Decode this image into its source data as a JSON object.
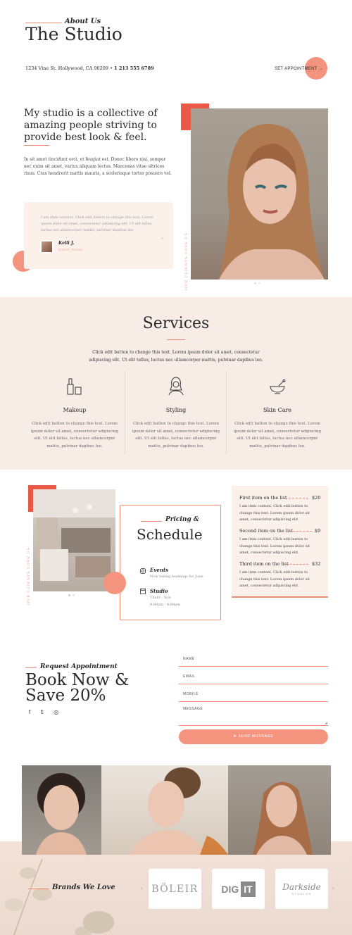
{
  "header": {
    "eyebrow": "About Us",
    "title": "The Studio",
    "address": "1234 Vine St. Hollywood, CA 90209",
    "bullet": "•",
    "phone": "1 213 555 6789",
    "appointment_label": "SET APPOINTMENT",
    "appointment_arrow": "→"
  },
  "about": {
    "headline_1": "My studio is a collective of",
    "headline_2": "amazing people striving to",
    "headline_3": "provide best look & feel.",
    "paragraph": "In sit amet tincidunt orci, et feugiat est. Donec libero nisi, semper nec enim sit amet, varius aliquam lectus. Maecenas vitae ultrices risus. Cras hendrerit mattis mauris, a scelerisque tortor posuere vel.",
    "testimonial_text": "I am slide content. Click edit button to change this text. Lorem ipsum dolor sit amet, consectetur adipiscing elit. Ut elit tellus, luctus nec ullamcorper mattis, pulvinar dapibus leo.",
    "testimonial_name": "Kelli J.",
    "testimonial_handle": "@kelli_beauty",
    "vertical_text": "OUR CLIENTS LOVE US"
  },
  "services": {
    "title": "Services",
    "description_1": "Click edit button to change this text. Lorem ipsum dolor sit amet, consectetur",
    "description_2": "adipiscing elit. Ut elit tellus, luctus nec ullamcorper mattis, pulvinar dapibus leo.",
    "items": [
      {
        "title": "Makeup",
        "icon": "makeup-icon",
        "text": "Click edit button to change this text. Lorem ipsum dolor sit amet, consectetur adipiscing elit. Ut elit tellus, luctus nec ullamcorper mattis, pulvinar dapibus leo."
      },
      {
        "title": "Styling",
        "icon": "woman-icon",
        "text": "Click edit button to change this text. Lorem ipsum dolor sit amet, consectetur adipiscing elit. Ut elit tellus, luctus nec ullamcorper mattis, pulvinar dapibus leo."
      },
      {
        "title": "Skin Care",
        "icon": "mortar-icon",
        "text": "Click edit button to change this text. Lorem ipsum dolor sit amet, consectetur adipiscing elit. Ut elit tellus, luctus nec ullamcorper mattis, pulvinar dapibus leo."
      }
    ]
  },
  "pricing": {
    "vertical_text": "OUR CLIENTS LOVE US",
    "eyebrow": "Pricing &",
    "title": "Schedule",
    "events_title": "Events",
    "events_text": "Now taking bookings for June",
    "studio_title": "Studio",
    "studio_days": "Thurs - Sun",
    "studio_hours": "8:00am - 8:00pm",
    "items": [
      {
        "title": "First item on the list",
        "price": "$20",
        "text": "I am item content. Click edit button to change this text. Lorem ipsum dolor sit amet, consectetur adipiscing elit."
      },
      {
        "title": "Second item on the list",
        "price": "$9",
        "text": "I am item content. Click edit button to change this text. Lorem ipsum dolor sit amet, consectetur adipiscing elit."
      },
      {
        "title": "Third item on the list",
        "price": "$32",
        "text": "I am item content. Click edit button to change this text. Lorem ipsum dolor sit amet, consectetur adipiscing elit."
      }
    ]
  },
  "contact": {
    "eyebrow": "Request Appointment",
    "headline_1": "Book Now &",
    "headline_2": "Save 20%",
    "social": [
      "f",
      "𝕥",
      "◎"
    ],
    "fields": [
      "NAME",
      "EMAIL",
      "MOBILE",
      "MESSAGE"
    ],
    "send_label": "➤ SEND MESSAGE"
  },
  "brands": {
    "title": "Brands We Love",
    "logos": [
      "BÖLEIR",
      "DIG",
      "IT",
      "Darkside",
      "STUDIOS"
    ],
    "prev": "‹",
    "next": "›"
  },
  "colors": {
    "accent": "#f08a75",
    "accent_fill": "#f4937e",
    "section_bg": "#f8ede6",
    "card_bg": "#fbf0ea"
  }
}
